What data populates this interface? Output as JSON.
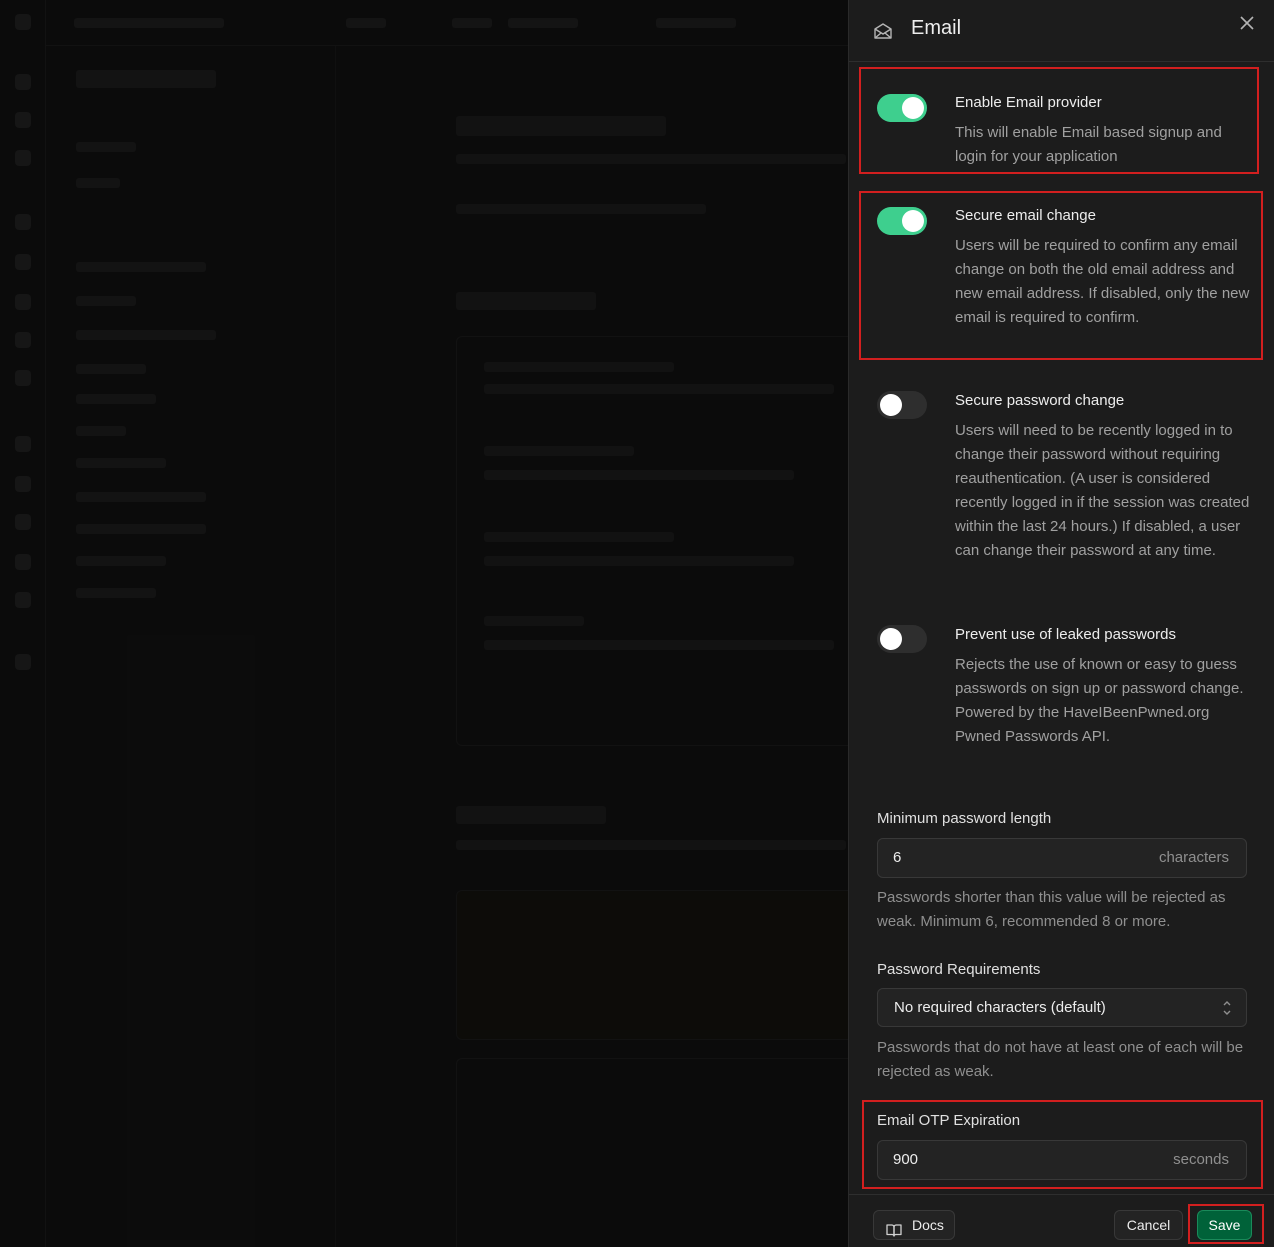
{
  "panel": {
    "title": "Email",
    "close_icon": "close-icon",
    "header_icon": "envelope-open-icon"
  },
  "settings": [
    {
      "title": "Enable Email provider",
      "description": "This will enable Email based signup and login for your application",
      "enabled": true
    },
    {
      "title": "Secure email change",
      "description": "Users will be required to confirm any email change on both the old email address and new email address. If disabled, only the new email is required to confirm.",
      "enabled": true
    },
    {
      "title": "Secure password change",
      "description": "Users will need to be recently logged in to change their password without requiring reauthentication. (A user is considered recently logged in if the session was created within the last 24 hours.) If disabled, a user can change their password at any time.",
      "enabled": false
    },
    {
      "title": "Prevent use of leaked passwords",
      "description": "Rejects the use of known or easy to guess passwords on sign up or password change. Powered by the HaveIBeenPwned.org Pwned Passwords API.",
      "enabled": false
    }
  ],
  "min_password": {
    "label": "Minimum password length",
    "value": "6",
    "suffix": "characters",
    "help": "Passwords shorter than this value will be rejected as weak. Minimum 6, recommended 8 or more."
  },
  "password_requirements": {
    "label": "Password Requirements",
    "selected": "No required characters (default)",
    "help": "Passwords that do not have at least one of each will be rejected as weak."
  },
  "otp_expiration": {
    "label": "Email OTP Expiration",
    "value": "900",
    "suffix": "seconds"
  },
  "footer": {
    "docs_label": "Docs",
    "cancel_label": "Cancel",
    "save_label": "Save"
  },
  "colors": {
    "toggle_on": "#3ecf8e",
    "save_button": "#006239",
    "highlight": "#d21f1f"
  }
}
